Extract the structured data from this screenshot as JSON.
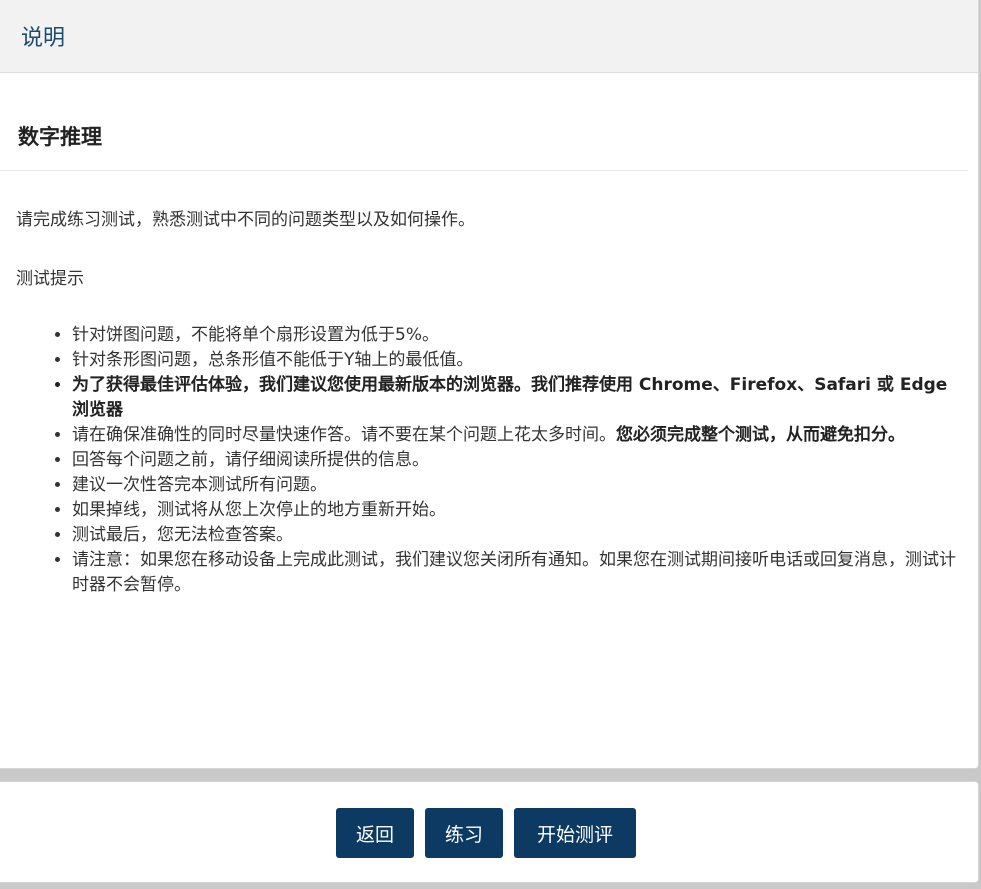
{
  "header": {
    "title": "说明"
  },
  "section": {
    "title": "数字推理"
  },
  "intro": "请完成练习测试，熟悉测试中不同的问题类型以及如何操作。",
  "tips": {
    "title": "测试提示",
    "items": [
      "针对饼图问题，不能将单个扇形设置为低于5%。",
      "针对条形图问题，总条形值不能低于Y轴上的最低值。",
      "为了获得最佳评估体验，我们建议您使用最新版本的浏览器。我们推荐使用 Chrome、Firefox、Safari 或 Edge 浏览器",
      {
        "normal": "请在确保准确性的同时尽量快速作答。请不要在某个问题上花太多时间。",
        "bold": "您必须完成整个测试，从而避免扣分。"
      },
      "回答每个问题之前，请仔细阅读所提供的信息。",
      "建议一次性答完本测试所有问题。",
      "如果掉线，测试将从您上次停止的地方重新开始。",
      "测试最后，您无法检查答案。",
      "请注意：如果您在移动设备上完成此测试，我们建议您关闭所有通知。如果您在测试期间接听电话或回复消息，测试计时器不会暂停。"
    ]
  },
  "footer": {
    "back_label": "返回",
    "practice_label": "练习",
    "start_label": "开始测评"
  },
  "colors": {
    "header_text": "#1a4a6e",
    "button_bg": "#0d3a63",
    "button_text": "#ffffff",
    "header_bg": "#f2f2f2",
    "page_bg": "#c9c9c9"
  }
}
